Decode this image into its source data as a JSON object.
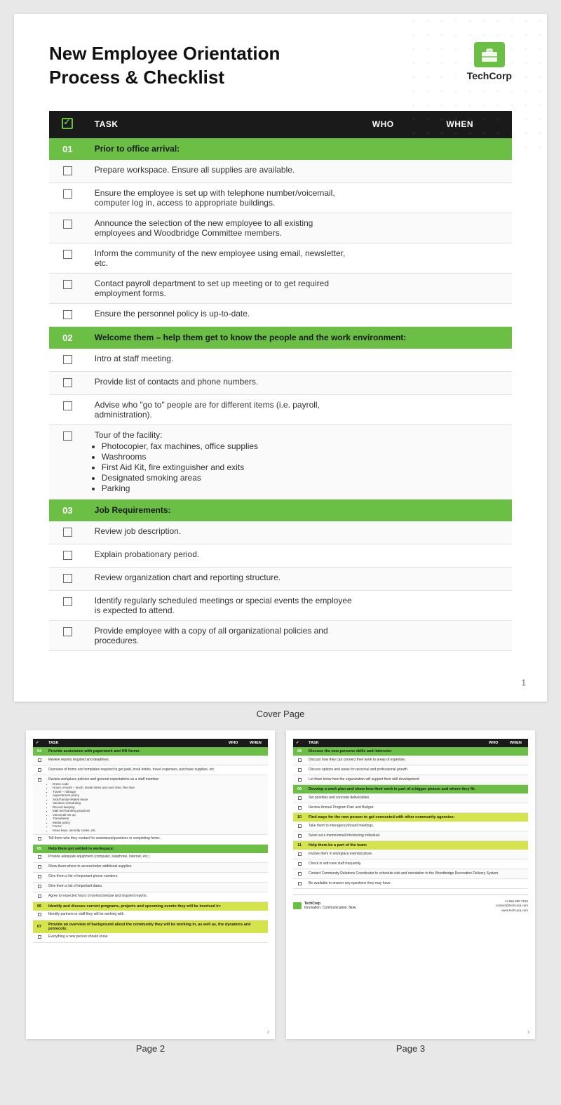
{
  "document": {
    "title_line1": "New Employee Orientation",
    "title_line2": "Process & Checklist",
    "logo_name": "TechCorp",
    "logo_alt": "briefcase-icon"
  },
  "table_headers": {
    "check": "✓",
    "task": "TASK",
    "who": "WHO",
    "when": "WHEN"
  },
  "sections": [
    {
      "num": "01",
      "title": "Prior to office arrival:",
      "color": "green",
      "tasks": [
        {
          "text": "Prepare workspace. Ensure all supplies are available.",
          "bullet": false
        },
        {
          "text": "Ensure the employee is set up with telephone number/voicemail, computer log in, access to appropriate buildings.",
          "bullet": false
        },
        {
          "text": "Announce the selection of the new employee to all existing employees and Woodbridge Committee members.",
          "bullet": false
        },
        {
          "text": "Inform the community of the new employee using email, newsletter, etc.",
          "bullet": false
        },
        {
          "text": "Contact payroll department to set up meeting or to get required employment forms.",
          "bullet": false
        },
        {
          "text": "Ensure the personnel policy is up-to-date.",
          "bullet": false
        }
      ]
    },
    {
      "num": "02",
      "title": "Welcome them – help them get to know the people and the work environment:",
      "color": "green",
      "tasks": [
        {
          "text": "Intro at staff meeting.",
          "bullet": false
        },
        {
          "text": "Provide list of contacts and phone numbers.",
          "bullet": false
        },
        {
          "text": "Advise who \"go to\" people are for different items (i.e. payroll, administration).",
          "bullet": false
        },
        {
          "text": "Tour of the facility:",
          "bullet": true,
          "items": [
            "Photocopier, fax machines, office supplies",
            "Washrooms",
            "First Aid Kit, fire extinguisher and exits",
            "Designated smoking areas",
            "Parking"
          ]
        }
      ]
    },
    {
      "num": "03",
      "title": "Job Requirements:",
      "color": "green",
      "tasks": [
        {
          "text": "Review job description.",
          "bullet": false
        },
        {
          "text": "Explain probationary period.",
          "bullet": false
        },
        {
          "text": "Review organization chart and reporting structure.",
          "bullet": false
        },
        {
          "text": "Identify regularly scheduled meetings or special events the employee is expected to attend.",
          "bullet": false
        },
        {
          "text": "Provide employee with a copy of all organizational policies and procedures.",
          "bullet": false
        }
      ]
    }
  ],
  "page_number": "1",
  "cover_label": "Cover Page",
  "page2_label": "Page 2",
  "page3_label": "Page 3",
  "page2": {
    "page_num": "2",
    "sections": [
      {
        "num": "04",
        "title": "Provide assistance with paperwork and HR forms:",
        "color": "green",
        "tasks": [
          {
            "text": "Review reports required and deadlines."
          },
          {
            "text": "Overview of forms and templates required to get paid, book hotels, travel expenses, purchase supplies, etc."
          },
          {
            "text": "Review workplace policies and general expectations as a staff member:",
            "items": [
              "Dress code",
              "Hours of work – lunch, break times and over time, flex time",
              "Travel – mileage",
              "Appointment policy",
              "Sick/Family-related leave",
              "Vacation scheduling",
              "Record keeping",
              "Mail and banking practices",
              "Voicemail set up",
              "Timesheets",
              "Media policy",
              "Forms",
              "Issue keys, security codes, etc."
            ]
          },
          {
            "text": "Tell them who they contact for assistance/questions in completing forms."
          }
        ]
      },
      {
        "num": "05",
        "title": "Help them get settled in workspace:",
        "color": "green",
        "tasks": [
          {
            "text": "Provide adequate equipment (computer, telephone, internet, etc.)"
          },
          {
            "text": "Show them where to access/order additional supplies."
          },
          {
            "text": "Give them a list of important phone numbers."
          },
          {
            "text": "Give them a list of important dates."
          },
          {
            "text": "Agree to expected hours of work/schedule and required reports."
          }
        ]
      },
      {
        "num": "06",
        "title": "Identify and discuss current programs, projects and upcoming events they will be involved in:",
        "color": "yellow",
        "tasks": [
          {
            "text": "Identify partners or staff they will be working with."
          }
        ]
      },
      {
        "num": "07",
        "title": "Provide an overview of background about the community they will be working in, as well as, the dynamics and protocols:",
        "color": "yellow",
        "tasks": [
          {
            "text": "Everything a new person should know."
          }
        ]
      }
    ]
  },
  "page3": {
    "page_num": "3",
    "sections": [
      {
        "num": "08",
        "title": "Discuss the new persons skills and interests:",
        "color": "green",
        "tasks": [
          {
            "text": "Discuss how they can connect their work to areas of expertise."
          },
          {
            "text": "Discuss options and areas for personal and professional growth."
          },
          {
            "text": "Let them know how the organization will support their skill development."
          }
        ]
      },
      {
        "num": "09",
        "title": "Develop a work plan and show how their work is part of a bigger picture and where they fit:",
        "color": "green",
        "tasks": [
          {
            "text": "Set priorities and concrete deliverables."
          },
          {
            "text": "Review Annual Program Plan and Budget."
          }
        ]
      },
      {
        "num": "10",
        "title": "Find ways for the new person to get connected with other community agencies:",
        "color": "yellow",
        "tasks": [
          {
            "text": "Take them to interagency/board meetings."
          },
          {
            "text": "Send out a memo/email introducing individual."
          }
        ]
      },
      {
        "num": "11",
        "title": "Help them be a part of the team:",
        "color": "yellow",
        "tasks": [
          {
            "text": "Involve them in workplace events/culture."
          },
          {
            "text": "Check in with new staff frequently."
          },
          {
            "text": "Contact Community Relations Coordinator to schedule visit and orientation to the Woodbridge Recreation Delivery System."
          },
          {
            "text": "Be available to answer any questions they may have."
          }
        ]
      }
    ],
    "footer": {
      "company": "TechCorp",
      "tagline": "Innovation. Communication. Now.",
      "phone": "+1 566 890 7210",
      "email": "contact@techcorp.com",
      "website": "www.techcorp.com"
    }
  }
}
